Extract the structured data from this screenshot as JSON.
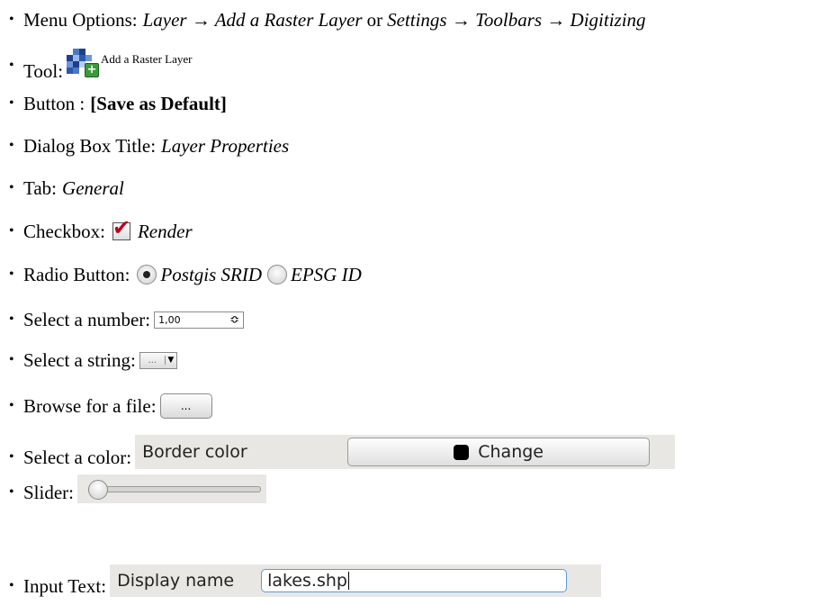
{
  "items": {
    "menu": {
      "label": "Menu Options:",
      "path1": "Layer → Add a Raster Layer",
      "or": "or",
      "path2": "Settings → Toolbars → Digitizing"
    },
    "tool": {
      "label": "Tool:",
      "icon": "add-raster-layer-icon",
      "caption": "Add a Raster Layer"
    },
    "button": {
      "label": "Button :",
      "value": "[Save as Default]"
    },
    "dialog": {
      "label": "Dialog Box Title:",
      "value": "Layer Properties"
    },
    "tab": {
      "label": "Tab:",
      "value": "General"
    },
    "checkbox": {
      "label": "Checkbox:",
      "value": "Render"
    },
    "radio": {
      "label": "Radio Button:",
      "option1": "Postgis SRID",
      "option2": "EPSG ID"
    },
    "number": {
      "label": "Select a number:",
      "value": "1,00",
      "arrows": "≎"
    },
    "string": {
      "label": "Select a string:",
      "value": "...",
      "arrow": "▼"
    },
    "browse": {
      "label": "Browse for a file:",
      "value": "..."
    },
    "color": {
      "label": "Select a color:",
      "field_label": "Border color",
      "button_label": "Change",
      "swatch": "#000000"
    },
    "slider": {
      "label": "Slider:",
      "value": 0
    },
    "input": {
      "label": "Input Text:",
      "field_label": "Display name",
      "value": "lakes.shp"
    }
  },
  "bullet": "•"
}
